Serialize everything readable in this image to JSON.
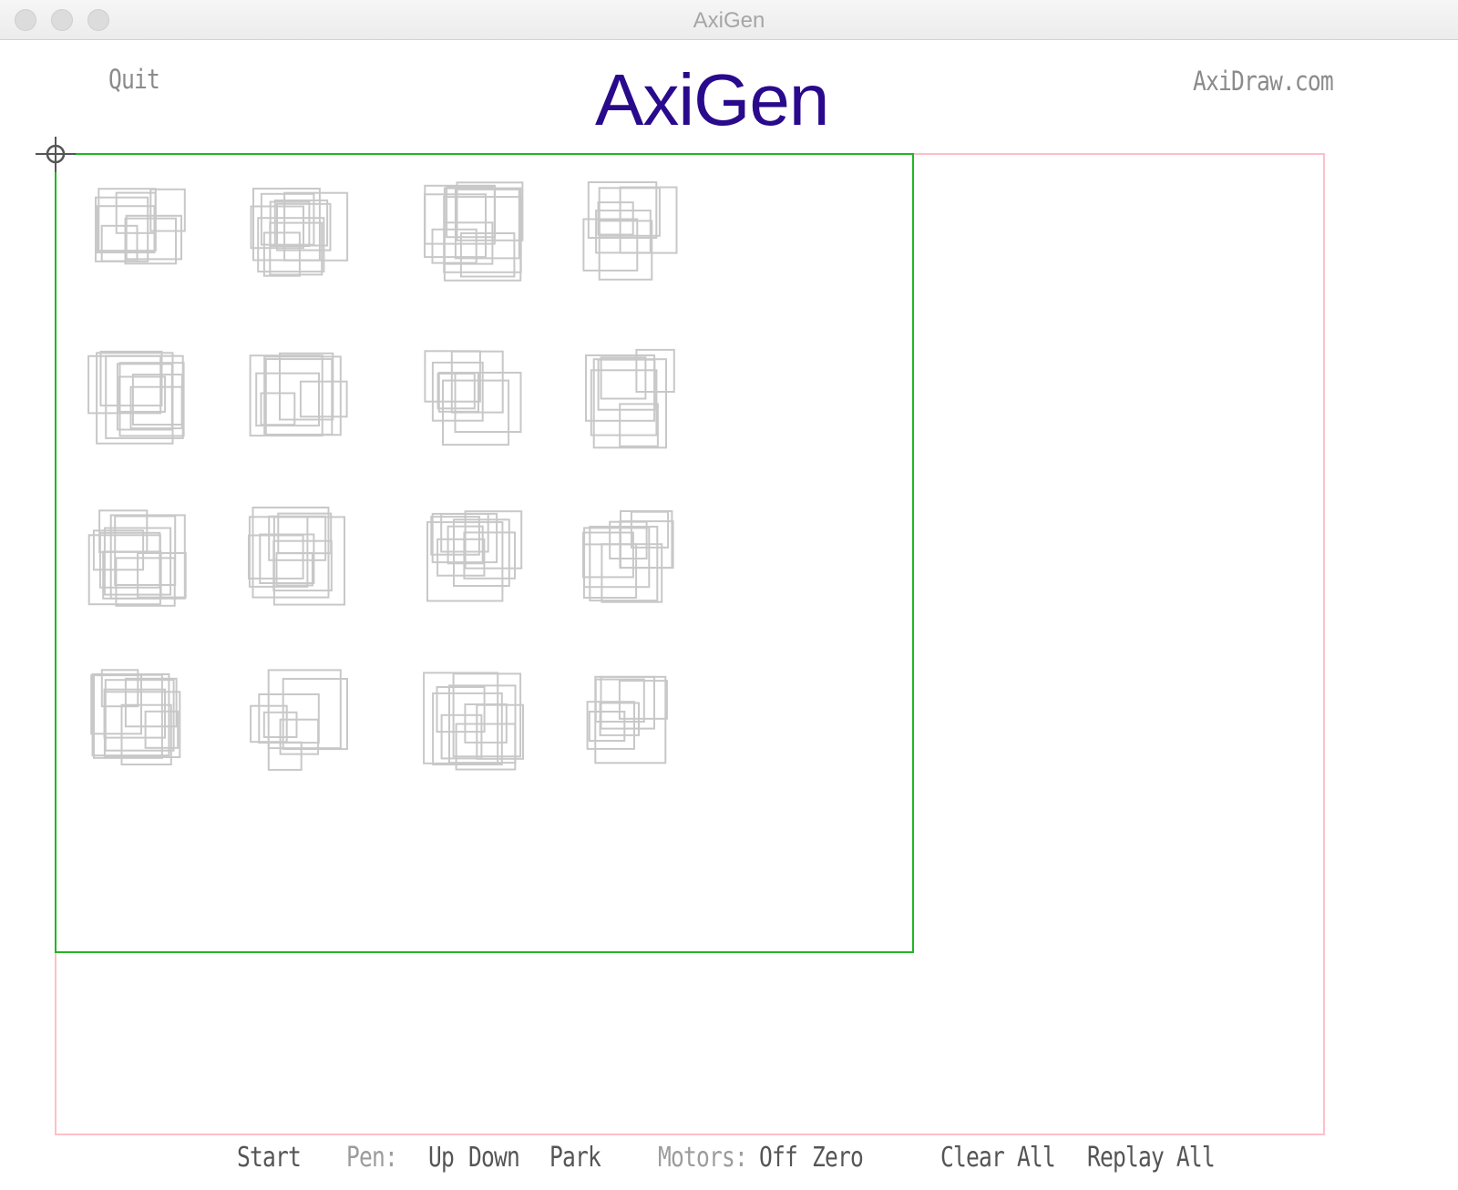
{
  "window": {
    "title": "AxiGen"
  },
  "header": {
    "quit_label": "Quit",
    "logo_text": "AxiGen",
    "site_link_label": "AxiDraw.com",
    "logo_color": "#2a0a8c"
  },
  "canvas": {
    "plot_area_color": "#22b622",
    "paper_border_color": "#ffc0c8",
    "shape_stroke_color": "#c8c8c8",
    "pattern": "overlapping squares",
    "grid_rows": 4,
    "grid_cols": 4
  },
  "toolbar": {
    "start_label": "Start",
    "pen_label": "Pen:",
    "pen_up_label": "Up",
    "pen_down_label": "Down",
    "pen_park_label": "Park",
    "motors_label": "Motors:",
    "motors_off_label": "Off",
    "motors_zero_label": "Zero",
    "clear_all_label": "Clear All",
    "replay_all_label": "Replay All"
  }
}
